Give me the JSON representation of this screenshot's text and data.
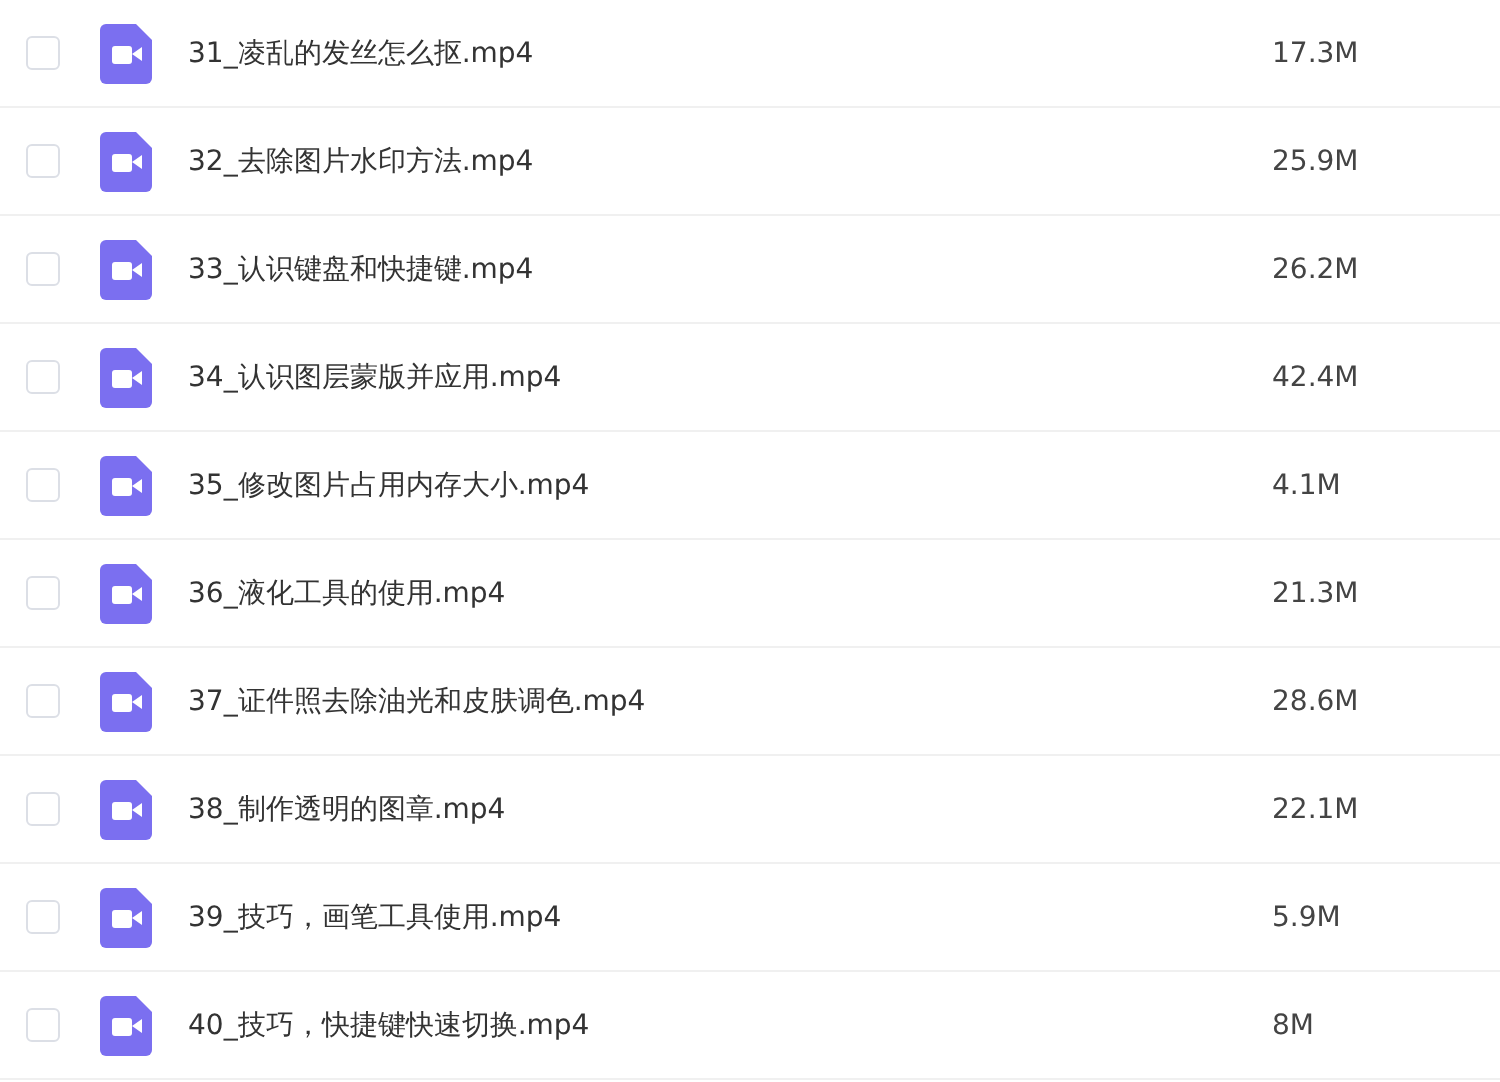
{
  "files": [
    {
      "name": "31_凌乱的发丝怎么抠.mp4",
      "size": "17.3M",
      "checked": false
    },
    {
      "name": "32_去除图片水印方法.mp4",
      "size": "25.9M",
      "checked": false
    },
    {
      "name": "33_认识键盘和快捷键.mp4",
      "size": "26.2M",
      "checked": false
    },
    {
      "name": "34_认识图层蒙版并应用.mp4",
      "size": "42.4M",
      "checked": false
    },
    {
      "name": "35_修改图片占用内存大小.mp4",
      "size": "4.1M",
      "checked": false
    },
    {
      "name": "36_液化工具的使用.mp4",
      "size": "21.3M",
      "checked": false
    },
    {
      "name": "37_证件照去除油光和皮肤调色.mp4",
      "size": "28.6M",
      "checked": false
    },
    {
      "name": "38_制作透明的图章.mp4",
      "size": "22.1M",
      "checked": false
    },
    {
      "name": "39_技巧，画笔工具使用.mp4",
      "size": "5.9M",
      "checked": false
    },
    {
      "name": "40_技巧，快捷键快速切换.mp4",
      "size": "8M",
      "checked": false
    }
  ]
}
